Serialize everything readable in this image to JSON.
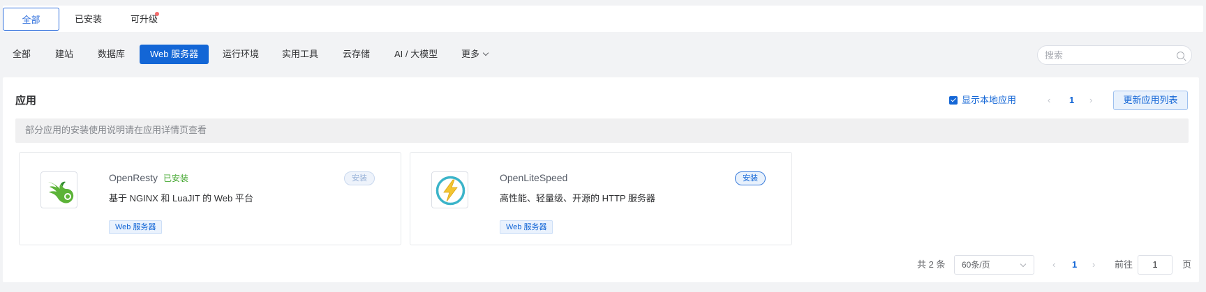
{
  "top_tabs": [
    {
      "label": "全部",
      "active": true
    },
    {
      "label": "已安装",
      "active": false
    },
    {
      "label": "可升级",
      "active": false,
      "badge_dot": true
    }
  ],
  "categories": [
    {
      "label": "全部"
    },
    {
      "label": "建站"
    },
    {
      "label": "数据库"
    },
    {
      "label": "Web 服务器",
      "active": true
    },
    {
      "label": "运行环境"
    },
    {
      "label": "实用工具"
    },
    {
      "label": "云存储"
    },
    {
      "label": "AI / 大模型"
    },
    {
      "label": "更多",
      "icon": "chevron-down-icon"
    }
  ],
  "search": {
    "placeholder": "搜索",
    "value": "",
    "icon": "search-icon"
  },
  "panel": {
    "title": "应用",
    "show_local_label": "显示本地应用",
    "show_local_checked": true,
    "top_page": "1",
    "update_button": "更新应用列表",
    "notice": "部分应用的安装使用说明请在应用详情页查看"
  },
  "apps": [
    {
      "name": "OpenResty",
      "installed_label": "已安装",
      "description": "基于 NGINX 和 LuaJIT 的 Web 平台",
      "tag": "Web 服务器",
      "install_label": "安装",
      "install_enabled": false,
      "icon": "openresty-logo"
    },
    {
      "name": "OpenLiteSpeed",
      "installed_label": "",
      "description": "高性能、轻量级、开源的 HTTP 服务器",
      "tag": "Web 服务器",
      "install_label": "安装",
      "install_enabled": true,
      "icon": "openlitespeed-logo"
    }
  ],
  "pagination": {
    "total_label": "共 2 条",
    "page_size": "60条/页",
    "current_page": "1",
    "goto_label": "前往",
    "goto_value": "1",
    "page_suffix": "页",
    "prev_arrow": "‹",
    "next_arrow": "›"
  },
  "colors": {
    "accent": "#1366d6",
    "installed_green": "#46a832",
    "badge_red": "#f56c6c"
  }
}
